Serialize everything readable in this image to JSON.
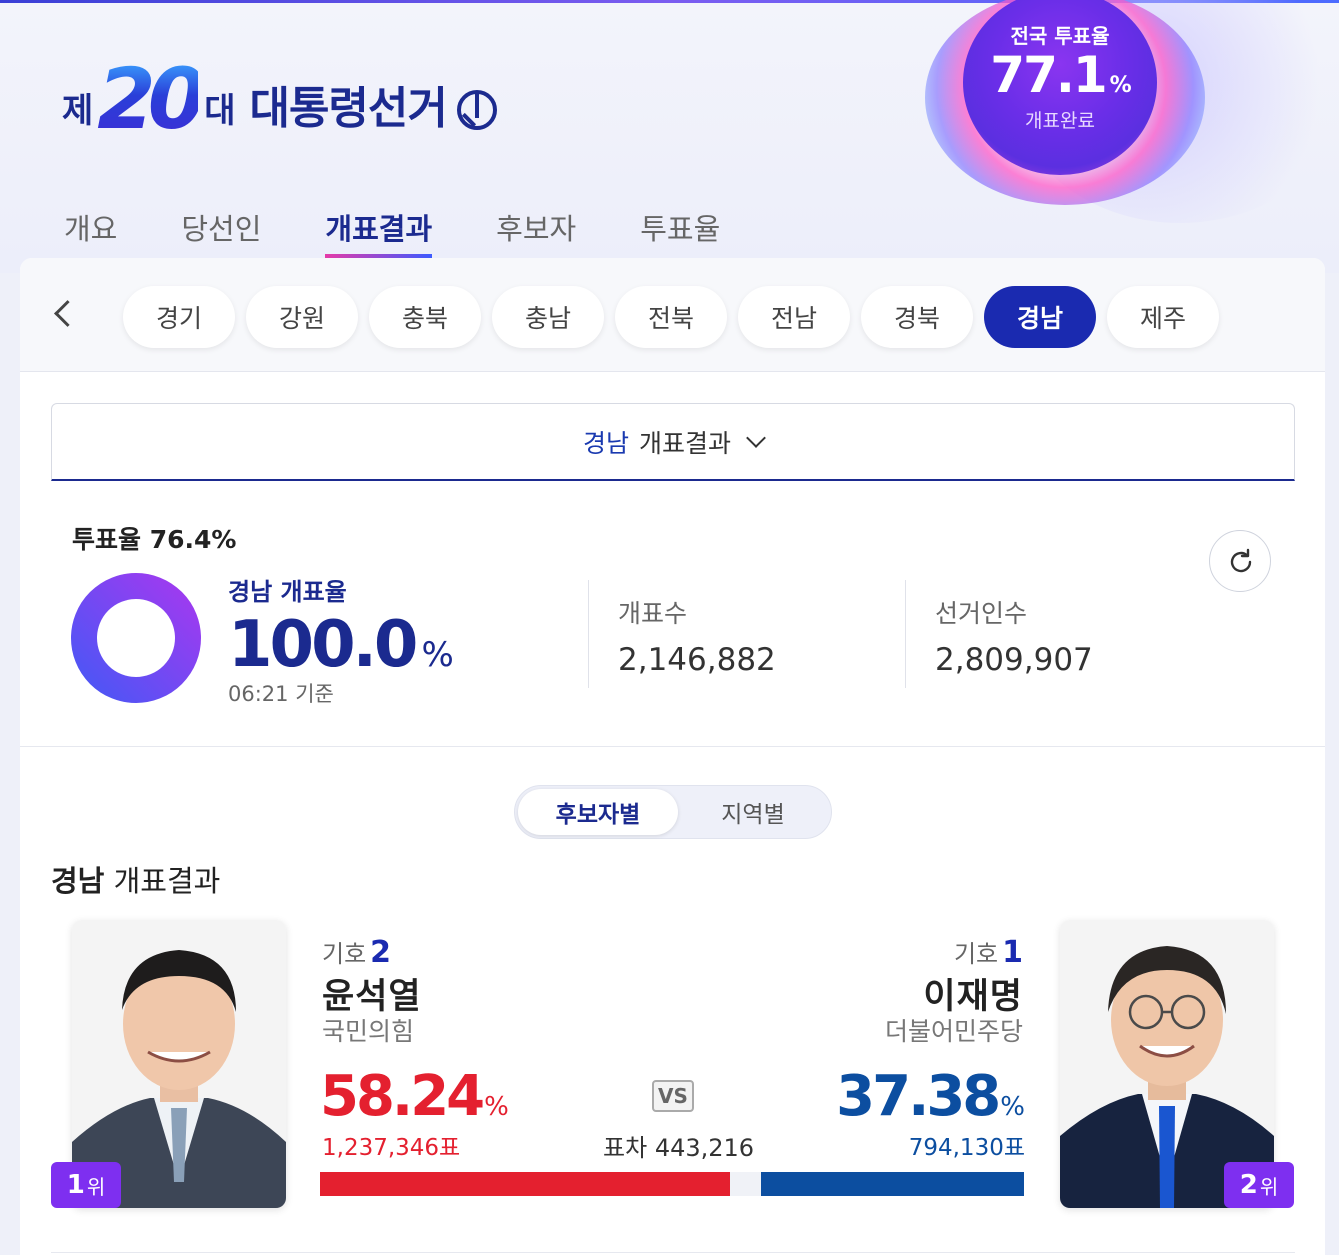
{
  "header": {
    "logo_prefix": "제",
    "logo_number": "20",
    "logo_suffix": "대",
    "logo_title": "대통령선거"
  },
  "national_turnout": {
    "label": "전국 투표율",
    "value": "77.1",
    "unit": "%",
    "status": "개표완료"
  },
  "main_tabs": [
    {
      "label": "개요",
      "active": false
    },
    {
      "label": "당선인",
      "active": false
    },
    {
      "label": "개표결과",
      "active": true
    },
    {
      "label": "후보자",
      "active": false
    },
    {
      "label": "투표율",
      "active": false
    }
  ],
  "regions": [
    {
      "label": "경기",
      "active": false
    },
    {
      "label": "강원",
      "active": false
    },
    {
      "label": "충북",
      "active": false
    },
    {
      "label": "충남",
      "active": false
    },
    {
      "label": "전북",
      "active": false
    },
    {
      "label": "전남",
      "active": false
    },
    {
      "label": "경북",
      "active": false
    },
    {
      "label": "경남",
      "active": true
    },
    {
      "label": "제주",
      "active": false
    }
  ],
  "dropdown": {
    "region": "경남",
    "label": "개표결과"
  },
  "summary": {
    "vote_rate_label": "투표율",
    "vote_rate_value": "76.4%",
    "count_label": "경남 개표율",
    "count_value": "100.0",
    "count_unit": "%",
    "count_progress": 1.0,
    "count_time": "06:21",
    "count_time_suffix": "기준",
    "counted_label": "개표수",
    "counted_value": "2,146,882",
    "electorate_label": "선거인수",
    "electorate_value": "2,809,907"
  },
  "view_toggle": {
    "on": "후보자별",
    "off": "지역별"
  },
  "result_title": {
    "region": "경남",
    "label": "개표결과"
  },
  "candidates": [
    {
      "rank": "1",
      "rank_suffix": "위",
      "no_label": "기호",
      "no": "2",
      "name": "윤석열",
      "party": "국민의힘",
      "pct": "58.24",
      "pct_unit": "%",
      "votes": "1,237,346표",
      "share": 58.24,
      "color": "#e4202f"
    },
    {
      "rank": "2",
      "rank_suffix": "위",
      "no_label": "기호",
      "no": "1",
      "name": "이재명",
      "party": "더불어민주당",
      "pct": "37.38",
      "pct_unit": "%",
      "votes": "794,130표",
      "share": 37.38,
      "color": "#0c4ea0"
    }
  ],
  "vs": {
    "label": "VS",
    "margin_label": "표차",
    "margin_value": "443,216"
  },
  "colors": {
    "accent": "#1b2a8f",
    "active_pill": "#1a2ab0",
    "rank_badge": "#7e2ff0",
    "donut": "#7b3cf0"
  }
}
